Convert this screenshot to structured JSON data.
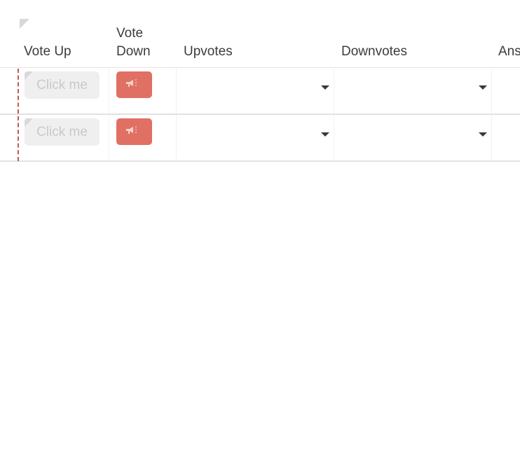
{
  "columns": {
    "vote_up": "Vote Up",
    "vote_down": "Vote Down",
    "upvotes": "Upvotes",
    "downvotes": "Downvotes",
    "answers_partial": "Ans"
  },
  "rows": [
    {
      "vote_up_label": "Click me",
      "upvotes_value": "",
      "downvotes_value": ""
    },
    {
      "vote_up_label": "Click me",
      "upvotes_value": "",
      "downvotes_value": ""
    }
  ],
  "colors": {
    "vote_down_button": "#e07063",
    "click_button_bg": "#efefef",
    "frozen_divider": "#c0584b"
  },
  "icons": {
    "vote_down_icon": "megaphone-icon",
    "dropdown_icon": "caret-down-icon"
  }
}
